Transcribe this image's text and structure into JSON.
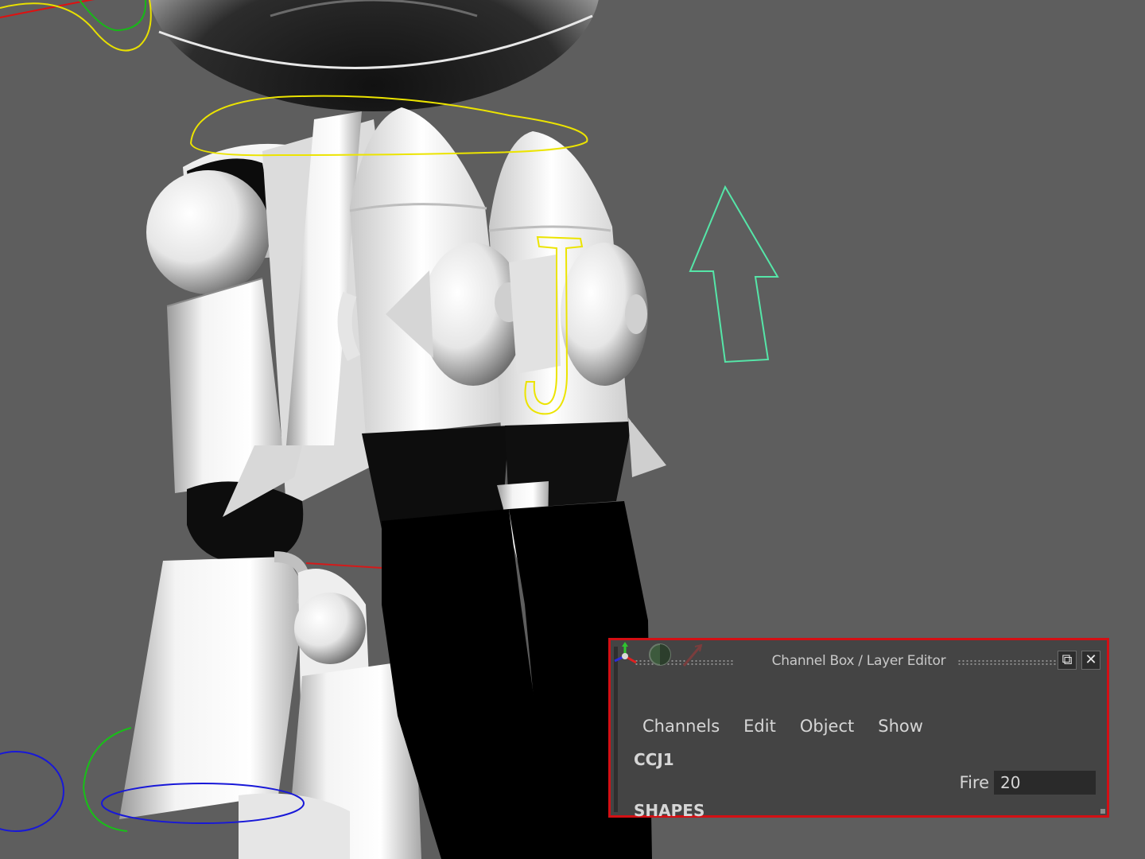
{
  "viewport": {
    "background_color": "#5e5e5e",
    "scene": "3D robot character model with animation control curves"
  },
  "channel_box": {
    "title": "Channel Box / Layer Editor",
    "border_color": "#d40f14",
    "restore_label": "⧉",
    "close_label": "✕",
    "menu": [
      "Channels",
      "Edit",
      "Object",
      "Show"
    ],
    "object_name": "CCJ1",
    "attribute": {
      "label": "Fire",
      "value": "20"
    },
    "section_label": "SHAPES",
    "icons": [
      "axis-gizmo-icon",
      "display-layer-icon",
      "curve-tool-icon"
    ]
  }
}
